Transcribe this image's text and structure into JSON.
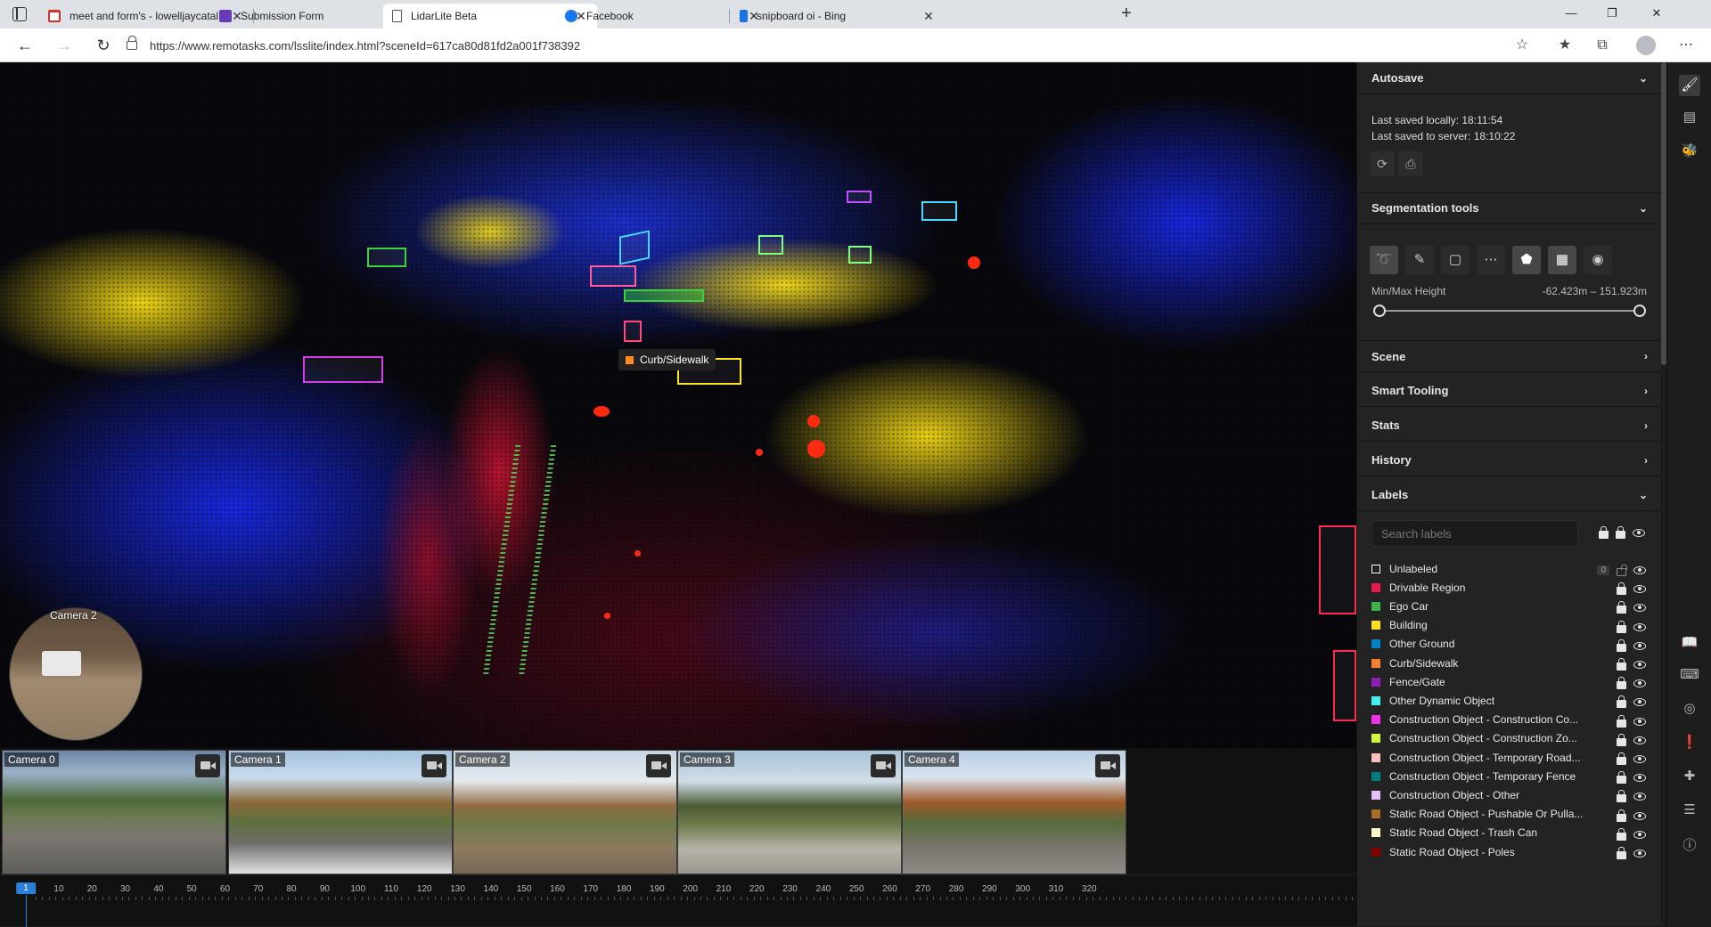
{
  "browser": {
    "tabs": [
      {
        "label": "meet and form's - lowelljaycatal",
        "favicon_color": "#d93025",
        "active": false
      },
      {
        "label": "Submission Form",
        "favicon_color": "#673ab7",
        "active": false
      },
      {
        "label": "LidarLite Beta",
        "favicon_color": "#ffffff",
        "active": true
      },
      {
        "label": "Facebook",
        "favicon_color": "#1877f2",
        "active": false
      },
      {
        "label": "snipboard oi - Bing",
        "favicon_color": "#1a73e8",
        "active": false
      }
    ],
    "url": "https://www.remotasks.com/lsslite/index.html?sceneId=617ca80d81fd2a001f738392"
  },
  "viewport": {
    "hover_label": "Curb/Sidewalk",
    "hover_color": "#ff8c1a",
    "mini_camera_label": "Camera 2"
  },
  "cameras": [
    {
      "label": "Camera 0"
    },
    {
      "label": "Camera 1"
    },
    {
      "label": "Camera 2"
    },
    {
      "label": "Camera 3"
    },
    {
      "label": "Camera 4"
    }
  ],
  "timeline": {
    "ticks": [
      "1",
      "10",
      "20",
      "30",
      "40",
      "50",
      "60",
      "70",
      "80",
      "90",
      "100",
      "110",
      "120",
      "130",
      "140",
      "150",
      "160",
      "170",
      "180",
      "190",
      "200",
      "210",
      "220",
      "230",
      "240",
      "250",
      "260",
      "270",
      "280",
      "290",
      "300",
      "310",
      "320"
    ],
    "current": "1"
  },
  "panel": {
    "autosave": {
      "title": "Autosave",
      "saved_locally": "Last saved locally: 18:11:54",
      "saved_server": "Last saved to server: 18:10:22"
    },
    "segmentation": {
      "title": "Segmentation tools",
      "minmax_label": "Min/Max Height",
      "minmax_value": "-62.423m – 151.923m"
    },
    "sections": [
      "Scene",
      "Smart Tooling",
      "Stats",
      "History"
    ],
    "labels": {
      "title": "Labels",
      "search_placeholder": "Search labels",
      "unlabeled_count": "0",
      "items": [
        {
          "name": "Unlabeled",
          "color": "#ffffff",
          "hollow": true
        },
        {
          "name": "Drivable Region",
          "color": "#e8194a"
        },
        {
          "name": "Ego Car",
          "color": "#3cb44b"
        },
        {
          "name": "Building",
          "color": "#ffe119"
        },
        {
          "name": "Other Ground",
          "color": "#0082c8"
        },
        {
          "name": "Curb/Sidewalk",
          "color": "#f58231"
        },
        {
          "name": "Fence/Gate",
          "color": "#911eb4"
        },
        {
          "name": "Other Dynamic Object",
          "color": "#46f0f0"
        },
        {
          "name": "Construction Object - Construction Co...",
          "color": "#f032e6"
        },
        {
          "name": "Construction Object - Construction Zo...",
          "color": "#d2f53c"
        },
        {
          "name": "Construction Object - Temporary Road...",
          "color": "#fabebe"
        },
        {
          "name": "Construction Object - Temporary Fence",
          "color": "#008080"
        },
        {
          "name": "Construction Object - Other",
          "color": "#e6beff"
        },
        {
          "name": "Static Road Object - Pushable Or Pulla...",
          "color": "#aa6e28"
        },
        {
          "name": "Static Road Object - Trash Can",
          "color": "#fffac8"
        },
        {
          "name": "Static Road Object - Poles",
          "color": "#800000"
        }
      ]
    }
  }
}
